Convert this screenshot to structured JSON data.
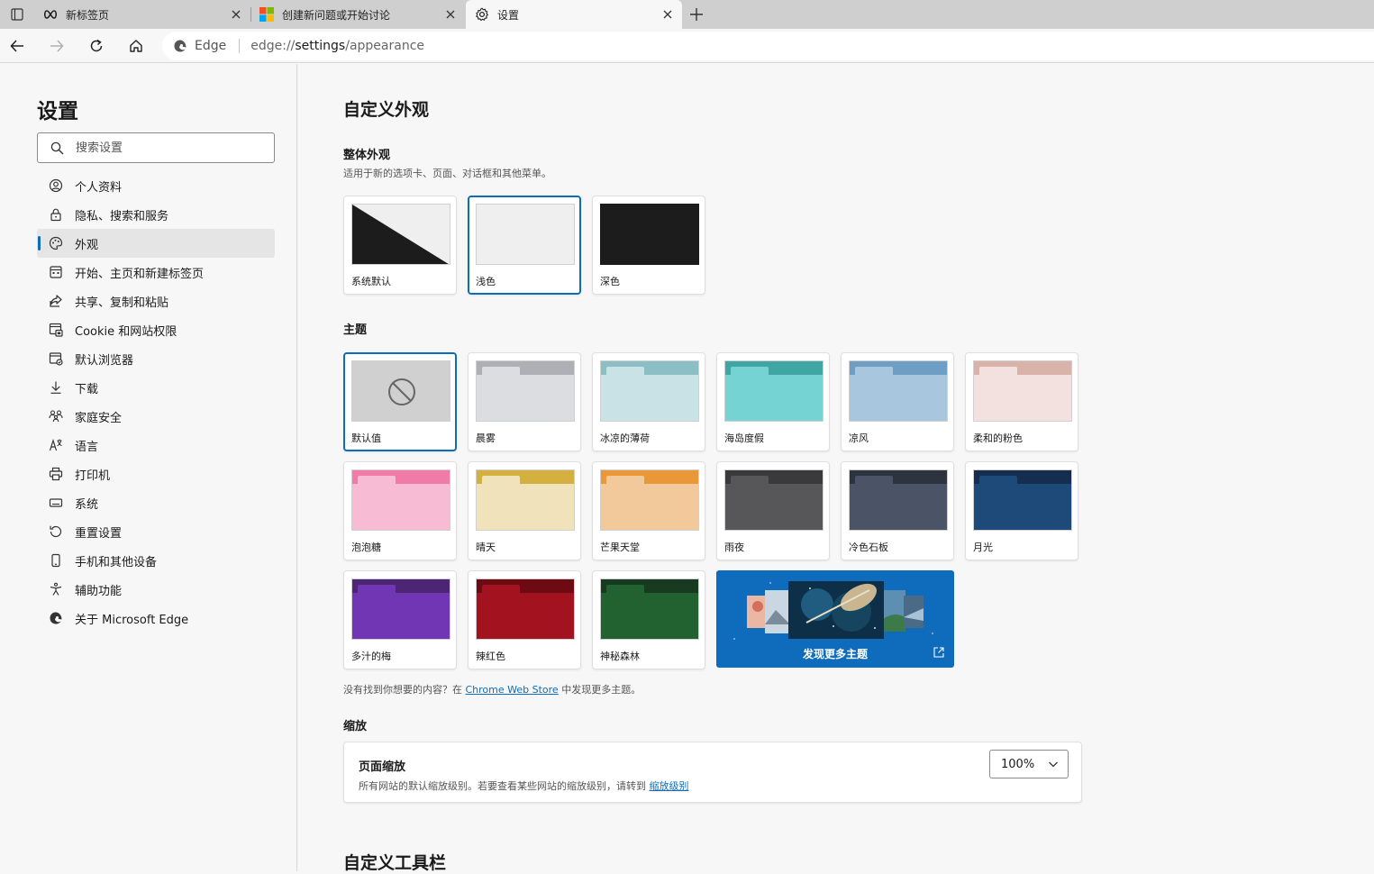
{
  "tabs": [
    {
      "title": "新标签页",
      "active": false
    },
    {
      "title": "创建新问题或开始讨论",
      "active": false
    },
    {
      "title": "设置",
      "active": true
    }
  ],
  "toolbar": {
    "site_label": "Edge",
    "url_scheme": "edge://",
    "url_host": "settings",
    "url_path": "/appearance"
  },
  "sidebar": {
    "title": "设置",
    "search_placeholder": "搜索设置",
    "items": [
      {
        "label": "个人资料",
        "icon": "profile-icon"
      },
      {
        "label": "隐私、搜索和服务",
        "icon": "lock-icon"
      },
      {
        "label": "外观",
        "icon": "palette-icon"
      },
      {
        "label": "开始、主页和新建标签页",
        "icon": "home-grid-icon"
      },
      {
        "label": "共享、复制和粘贴",
        "icon": "share-icon"
      },
      {
        "label": "Cookie 和网站权限",
        "icon": "cookie-icon"
      },
      {
        "label": "默认浏览器",
        "icon": "browser-icon"
      },
      {
        "label": "下载",
        "icon": "download-icon"
      },
      {
        "label": "家庭安全",
        "icon": "family-icon"
      },
      {
        "label": "语言",
        "icon": "language-icon"
      },
      {
        "label": "打印机",
        "icon": "printer-icon"
      },
      {
        "label": "系统",
        "icon": "system-icon"
      },
      {
        "label": "重置设置",
        "icon": "reset-icon"
      },
      {
        "label": "手机和其他设备",
        "icon": "phone-icon"
      },
      {
        "label": "辅助功能",
        "icon": "accessibility-icon"
      },
      {
        "label": "关于 Microsoft Edge",
        "icon": "edge-logo-icon"
      }
    ]
  },
  "main": {
    "title": "自定义外观",
    "overall": {
      "heading": "整体外观",
      "description": "适用于新的选项卡、页面、对话框和其他菜单。",
      "options": [
        {
          "label": "系统默认",
          "selected": false
        },
        {
          "label": "浅色",
          "selected": true
        },
        {
          "label": "深色",
          "selected": false
        }
      ]
    },
    "themes": {
      "heading": "主题",
      "items": [
        {
          "label": "默认值",
          "selected": true,
          "band": "#d0d0d0",
          "body": "#d0d0d0"
        },
        {
          "label": "晨雾",
          "selected": false,
          "band": "#aeb0b5",
          "body": "#dcdde0",
          "tab": "#dcdde0"
        },
        {
          "label": "冰凉的薄荷",
          "selected": false,
          "band": "#8cbfc5",
          "body": "#c8e2e5",
          "tab": "#c8e2e5"
        },
        {
          "label": "海岛度假",
          "selected": false,
          "band": "#3fa6a4",
          "body": "#75d3d3",
          "tab": "#75d3d3"
        },
        {
          "label": "凉风",
          "selected": false,
          "band": "#6f9ec4",
          "body": "#a8c7de",
          "tab": "#a8c7de"
        },
        {
          "label": "柔和的粉色",
          "selected": false,
          "band": "#d9b2aa",
          "body": "#f3e1df",
          "tab": "#f3e1df"
        },
        {
          "label": "泡泡糖",
          "selected": false,
          "band": "#f07aa8",
          "body": "#f7bcd4",
          "tab": "#f7bcd4"
        },
        {
          "label": "晴天",
          "selected": false,
          "band": "#d4b040",
          "body": "#f0e2ba",
          "tab": "#f0e2ba"
        },
        {
          "label": "芒果天堂",
          "selected": false,
          "band": "#e89838",
          "body": "#f1c99a",
          "tab": "#f1c99a"
        },
        {
          "label": "雨夜",
          "selected": false,
          "band": "#3a3a3c",
          "body": "#57575a",
          "tab": "#57575a"
        },
        {
          "label": "冷色石板",
          "selected": false,
          "band": "#2d3440",
          "body": "#4a5466",
          "tab": "#4a5466"
        },
        {
          "label": "月光",
          "selected": false,
          "band": "#152d4e",
          "body": "#1e4a7a",
          "tab": "#1e4a7a"
        },
        {
          "label": "多汁的梅",
          "selected": false,
          "band": "#4c2574",
          "body": "#7136b4",
          "tab": "#7136b4"
        },
        {
          "label": "辣红色",
          "selected": false,
          "band": "#6e0a12",
          "body": "#a3121f",
          "tab": "#a3121f"
        },
        {
          "label": "神秘森林",
          "selected": false,
          "band": "#173a20",
          "body": "#226230",
          "tab": "#226230"
        }
      ],
      "discover_label": "发现更多主题",
      "store_note_before": "没有找到你想要的内容？在 ",
      "store_link": "Chrome Web Store",
      "store_note_after": " 中发现更多主题。"
    },
    "zoom": {
      "heading": "缩放",
      "card_title": "页面缩放",
      "card_desc": "所有网站的默认缩放级别。若要查看某些网站的缩放级别，请转到 ",
      "card_link": "缩放级别",
      "value": "100%"
    },
    "toolbar_heading": "自定义工具栏"
  },
  "colors": {
    "accent": "#0f6cbd",
    "dark": "#1c1c1c",
    "light": "#efefef"
  }
}
